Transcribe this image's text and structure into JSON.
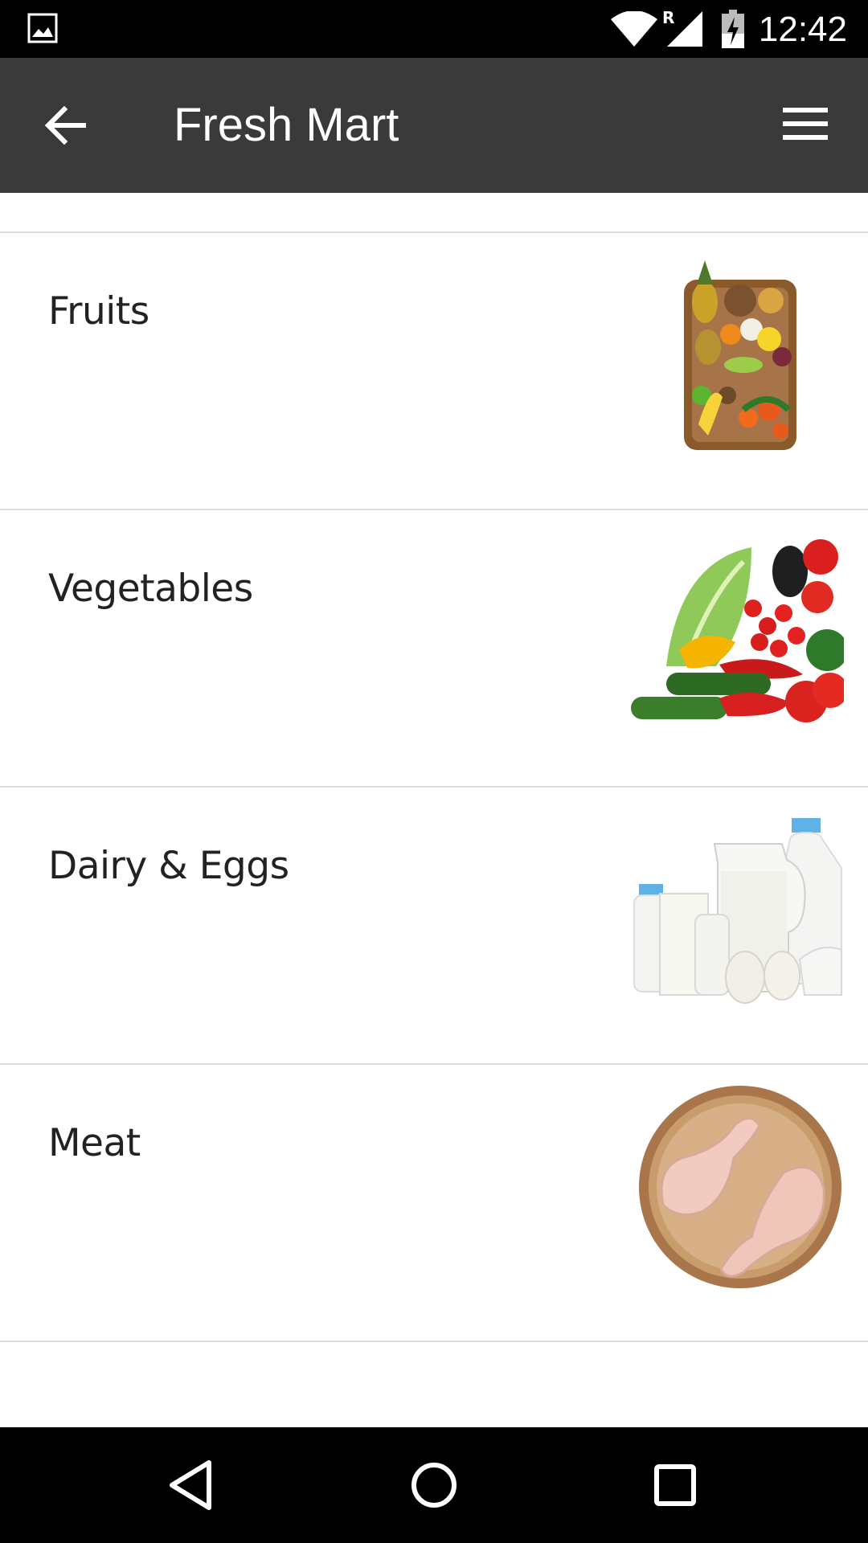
{
  "status_bar": {
    "time": "12:42",
    "roaming_indicator": "R",
    "icons": [
      "gallery-icon",
      "wifi-icon",
      "signal-icon",
      "battery-charging-icon"
    ]
  },
  "app_bar": {
    "title": "Fresh Mart",
    "back_icon": "arrow-left-icon",
    "menu_icon": "hamburger-menu-icon"
  },
  "categories": [
    {
      "label": "Fruits",
      "image": "fruit-basket"
    },
    {
      "label": "Vegetables",
      "image": "vegetables-pile"
    },
    {
      "label": "Dairy & Eggs",
      "image": "milk-and-eggs"
    },
    {
      "label": "Meat",
      "image": "chicken-legs-on-board"
    }
  ],
  "nav_bar": {
    "icons": [
      "nav-back-icon",
      "nav-home-icon",
      "nav-recents-icon"
    ]
  },
  "colors": {
    "status_bar": "#000000",
    "app_bar": "#3a3a3a",
    "divider": "#dcdcdc",
    "label_text": "#222222"
  }
}
